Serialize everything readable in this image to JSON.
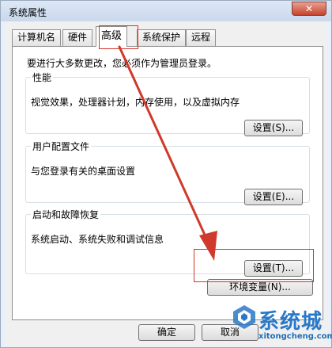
{
  "window": {
    "title": "系统属性",
    "close_glyph": "✕"
  },
  "tabs": [
    {
      "label": "计算机名",
      "active": false
    },
    {
      "label": "硬件",
      "active": false
    },
    {
      "label": "高级",
      "active": true
    },
    {
      "label": "系统保护",
      "active": false
    },
    {
      "label": "远程",
      "active": false
    }
  ],
  "advanced": {
    "notice": "要进行大多数更改，您必须作为管理员登录。",
    "performance": {
      "legend": "性能",
      "description": "视觉效果，处理器计划，内存使用，以及虚拟内存",
      "button": "设置(S)..."
    },
    "user_profiles": {
      "legend": "用户配置文件",
      "description": "与您登录有关的桌面设置",
      "button": "设置(E)..."
    },
    "startup_recovery": {
      "legend": "启动和故障恢复",
      "description": "系统启动、系统失败和调试信息",
      "button": "设置(T)..."
    },
    "env_button": "环境变量(N)..."
  },
  "footer": {
    "ok": "确定",
    "cancel": "取消"
  },
  "watermark": {
    "brand": "系统城",
    "domain": "xitongcheng.com"
  },
  "colors": {
    "annotation_red": "#d0392b",
    "watermark_blue": "#2a78c8",
    "window_border": "#9aa9bd"
  }
}
